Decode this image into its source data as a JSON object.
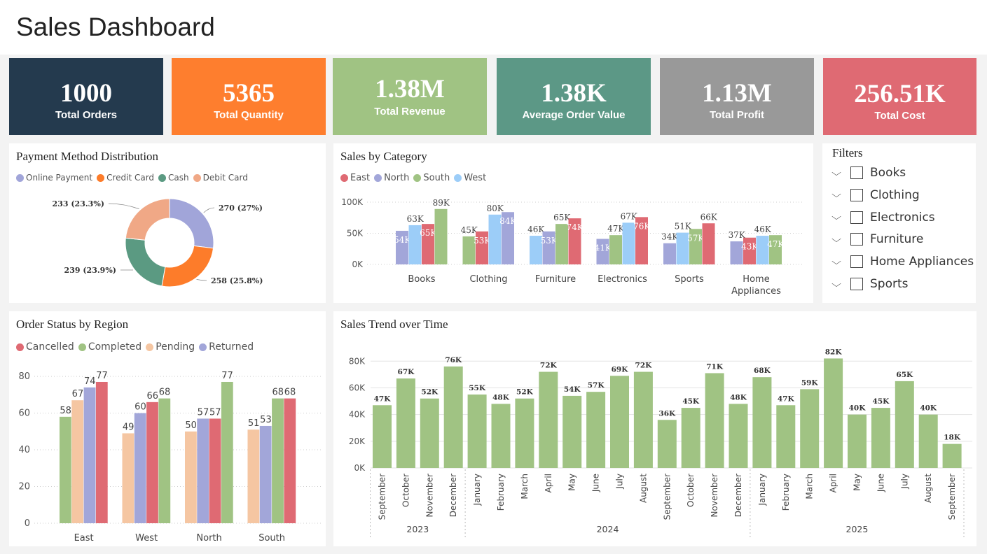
{
  "page_title": "Sales Dashboard",
  "kpis": [
    {
      "value": "1000",
      "label": "Total Orders",
      "color": "#243a4e"
    },
    {
      "value": "5365",
      "label": "Total Quantity",
      "color": "#fe7e2e"
    },
    {
      "value": "1.38M",
      "label": "Total Revenue",
      "color": "#a0c383"
    },
    {
      "value": "1.38K",
      "label": "Average Order Value",
      "color": "#5c9886"
    },
    {
      "value": "1.13M",
      "label": "Total Profit",
      "color": "#999999"
    },
    {
      "value": "256.51K",
      "label": "Total Cost",
      "color": "#df6a73"
    }
  ],
  "filters": {
    "title": "Filters",
    "items": [
      "Books",
      "Clothing",
      "Electronics",
      "Furniture",
      "Home Appliances",
      "Sports"
    ]
  },
  "panels": {
    "payment": "Payment Method Distribution",
    "category": "Sales by Category",
    "order_status": "Order Status by Region",
    "trend": "Sales Trend over Time"
  },
  "chart_data": [
    {
      "id": "payment",
      "type": "pie",
      "title": "Payment Method Distribution",
      "legend_position": "top-left",
      "series": [
        {
          "name": "Online Payment",
          "value": 270,
          "label": "270 (27%)",
          "color": "#a1a5d9"
        },
        {
          "name": "Credit Card",
          "value": 258,
          "label": "258 (25.8%)",
          "color": "#fd7c2a"
        },
        {
          "name": "Cash",
          "value": 239,
          "label": "239 (23.9%)",
          "color": "#5b9a82"
        },
        {
          "name": "Debit Card",
          "value": 233,
          "label": "233 (23.3%)",
          "color": "#f0a886"
        }
      ]
    },
    {
      "id": "category",
      "type": "bar",
      "title": "Sales by Category",
      "legend_position": "top-left",
      "categories": [
        "Books",
        "Clothing",
        "Furniture",
        "Electronics",
        "Sports",
        "Home Appliances"
      ],
      "order": [
        [
          "North",
          "West",
          "East",
          "South"
        ],
        [
          "South",
          "East",
          "West",
          "North"
        ],
        [
          "West",
          "North",
          "South",
          "East"
        ],
        [
          "North",
          "South",
          "West",
          "East"
        ],
        [
          "North",
          "West",
          "South",
          "East"
        ],
        [
          "North",
          "East",
          "West",
          "South"
        ]
      ],
      "series": [
        {
          "name": "East",
          "color": "#df6a73",
          "values": [
            65,
            53,
            74,
            76,
            66,
            43
          ],
          "labels": [
            "65K",
            "53K",
            "74K",
            "76K",
            "66K",
            "43K"
          ]
        },
        {
          "name": "North",
          "color": "#a2a6d9",
          "values": [
            54,
            84,
            53,
            41,
            34,
            37
          ],
          "labels": [
            "54K",
            "84K",
            "53K",
            "41K",
            "34K",
            "37K"
          ]
        },
        {
          "name": "South",
          "color": "#a0c383",
          "values": [
            89,
            45,
            65,
            47,
            57,
            47
          ],
          "labels": [
            "89K",
            "45K",
            "65K",
            "47K",
            "57K",
            "47K"
          ]
        },
        {
          "name": "West",
          "color": "#9ccdf8",
          "values": [
            63,
            80,
            46,
            67,
            51,
            46
          ],
          "labels": [
            "63K",
            "80K",
            "46K",
            "67K",
            "51K",
            "46K"
          ]
        }
      ],
      "yticks": [
        "0K",
        "50K",
        "100K"
      ],
      "ylim": [
        0,
        100
      ],
      "grid": true
    },
    {
      "id": "order_status",
      "type": "bar",
      "title": "Order Status by Region",
      "legend_position": "top-left",
      "categories": [
        "East",
        "West",
        "North",
        "South"
      ],
      "order": [
        [
          "Completed",
          "Pending",
          "Returned",
          "Cancelled"
        ],
        [
          "Pending",
          "Returned",
          "Cancelled",
          "Completed"
        ],
        [
          "Pending",
          "Returned",
          "Cancelled",
          "Completed"
        ],
        [
          "Pending",
          "Returned",
          "Completed",
          "Cancelled"
        ]
      ],
      "series": [
        {
          "name": "Cancelled",
          "color": "#df6a73",
          "values": [
            77,
            66,
            57,
            68
          ]
        },
        {
          "name": "Completed",
          "color": "#a0c383",
          "values": [
            58,
            68,
            77,
            68
          ]
        },
        {
          "name": "Pending",
          "color": "#f5c6a2",
          "values": [
            67,
            49,
            50,
            51
          ]
        },
        {
          "name": "Returned",
          "color": "#a2a6d9",
          "values": [
            74,
            60,
            57,
            53
          ]
        }
      ],
      "yticks": [
        "0",
        "20",
        "40",
        "60",
        "80"
      ],
      "ylim": [
        0,
        85
      ],
      "grid": true
    },
    {
      "id": "trend",
      "type": "bar",
      "title": "Sales Trend over Time",
      "color": "#a0c383",
      "x": [
        "September",
        "October",
        "November",
        "December",
        "January",
        "February",
        "March",
        "April",
        "May",
        "June",
        "July",
        "August",
        "September",
        "October",
        "November",
        "December",
        "January",
        "February",
        "March",
        "April",
        "May",
        "June",
        "July",
        "August",
        "September"
      ],
      "values": [
        47,
        67,
        52,
        76,
        55,
        48,
        52,
        72,
        54,
        57,
        69,
        72,
        36,
        45,
        71,
        48,
        68,
        47,
        59,
        82,
        40,
        45,
        65,
        40,
        18
      ],
      "labels": [
        "47K",
        "67K",
        "52K",
        "76K",
        "55K",
        "48K",
        "52K",
        "72K",
        "54K",
        "57K",
        "69K",
        "72K",
        "36K",
        "45K",
        "71K",
        "48K",
        "68K",
        "47K",
        "59K",
        "82K",
        "40K",
        "45K",
        "65K",
        "40K",
        "18K"
      ],
      "years": [
        {
          "label": "2023",
          "count": 4
        },
        {
          "label": "2024",
          "count": 12
        },
        {
          "label": "2025",
          "count": 9
        }
      ],
      "yticks": [
        "0K",
        "20K",
        "40K",
        "60K",
        "80K"
      ],
      "ylim": [
        0,
        88
      ],
      "grid": true
    }
  ]
}
